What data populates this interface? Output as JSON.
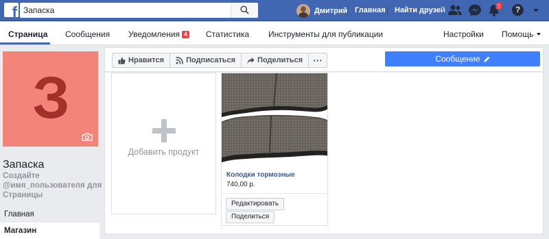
{
  "topbar": {
    "search_value": "Запаска",
    "user_name": "Дмитрий",
    "home_label": "Главная",
    "find_friends_label": "Найти друзей",
    "notifications_count": "1",
    "help_label": "?"
  },
  "tabs": {
    "page": "Страница",
    "messages": "Сообщения",
    "notifications": "Уведомления",
    "notifications_badge": "4",
    "statistics": "Статистика",
    "publishing_tools": "Инструменты для публикации",
    "settings": "Настройки",
    "help": "Помощь"
  },
  "left": {
    "avatar_letter": "З",
    "page_name": "Запаска",
    "create_username": "Создайте @имя_пользователя для Страницы",
    "nav": [
      "Главная",
      "Магазин"
    ]
  },
  "actions": {
    "like": "Нравится",
    "follow": "Подписаться",
    "share": "Поделиться",
    "more": "···",
    "message": "Сообщение"
  },
  "shop": {
    "add_product": "Добавить продукт",
    "product": {
      "title": "Колодки тормозные",
      "price": "740,00 р.",
      "edit": "Редактировать",
      "share": "Поделиться"
    }
  },
  "colors": {
    "brand_blue": "#4267b2",
    "message_blue": "#4080ff",
    "avatar_bg": "#f28479",
    "avatar_letter": "#a3302a",
    "badge_red": "#fa3e3e"
  }
}
